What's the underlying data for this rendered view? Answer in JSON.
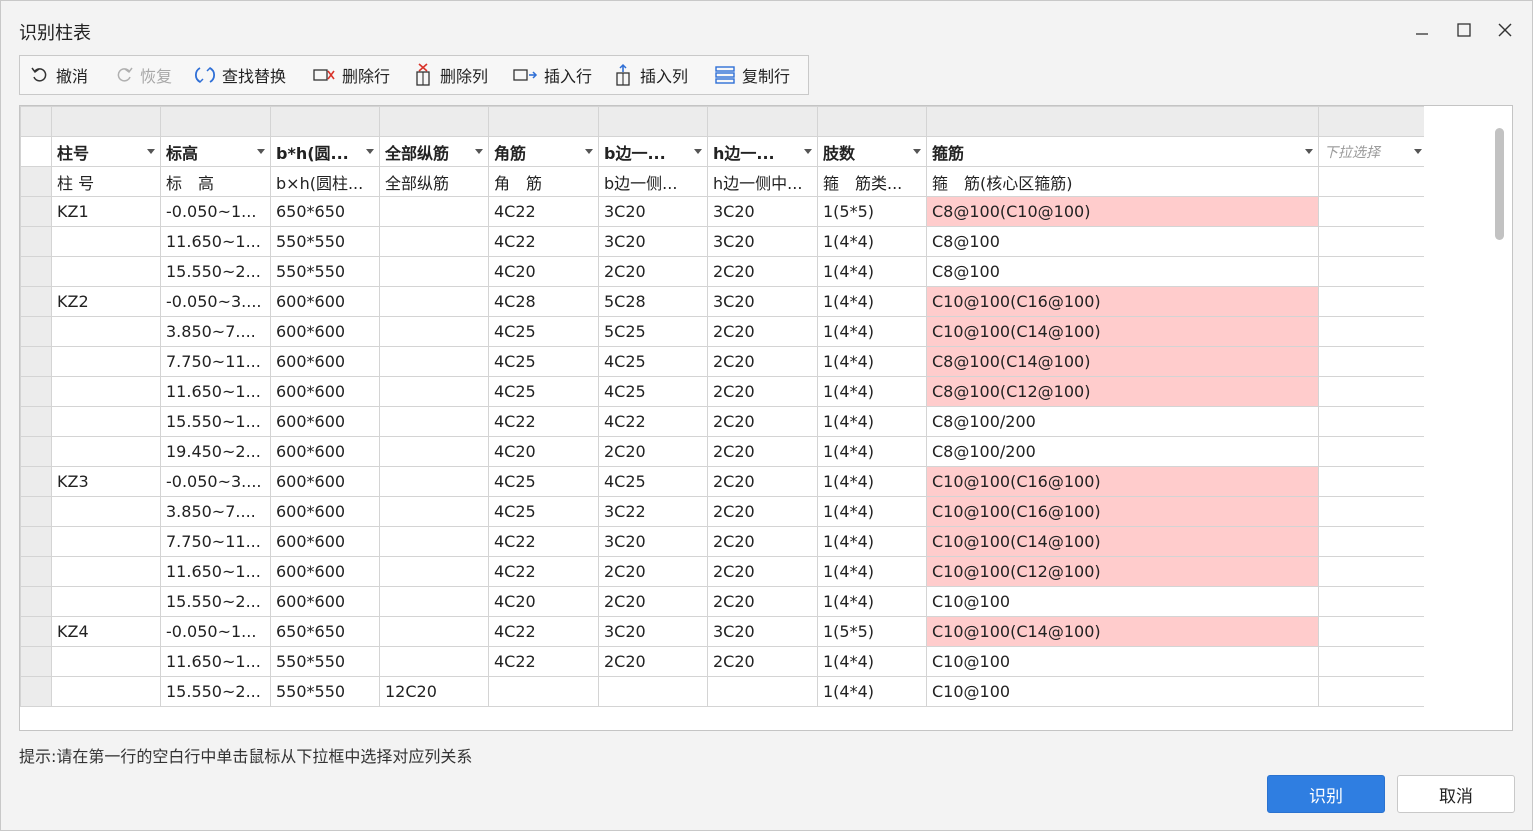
{
  "dialog": {
    "title": "识别柱表"
  },
  "toolbar": {
    "undo": "撤消",
    "redo": "恢复",
    "find_replace": "查找替换",
    "delete_row": "删除行",
    "delete_col": "删除列",
    "insert_row": "插入行",
    "insert_col": "插入列",
    "copy_row": "复制行"
  },
  "table": {
    "header": [
      "柱号",
      "标高",
      "b*h(圆...",
      "全部纵筋",
      "角筋",
      "b边一...",
      "h边一...",
      "肢数",
      "箍筋",
      "下拉选择"
    ],
    "subheader": [
      "柱 号",
      "标　高",
      "b×h(圆柱...",
      "全部纵筋",
      "角　筋",
      "b边一侧...",
      "h边一侧中...",
      "箍　筋类...",
      "箍　筋(核心区箍筋)",
      ""
    ],
    "rows": [
      {
        "c": [
          "KZ1",
          "-0.050~1...",
          "650*650",
          "",
          "4C22",
          "3C20",
          "3C20",
          "1(5*5)",
          "C8@100(C10@100)",
          ""
        ],
        "hl": true
      },
      {
        "c": [
          "",
          "11.650~1...",
          "550*550",
          "",
          "4C22",
          "3C20",
          "3C20",
          "1(4*4)",
          "C8@100",
          ""
        ],
        "hl": false
      },
      {
        "c": [
          "",
          "15.550~2...",
          "550*550",
          "",
          "4C20",
          "2C20",
          "2C20",
          "1(4*4)",
          "C8@100",
          ""
        ],
        "hl": false
      },
      {
        "c": [
          "KZ2",
          "-0.050~3....",
          "600*600",
          "",
          "4C28",
          "5C28",
          "3C20",
          "1(4*4)",
          "C10@100(C16@100)",
          ""
        ],
        "hl": true
      },
      {
        "c": [
          "",
          "3.850~7....",
          "600*600",
          "",
          "4C25",
          "5C25",
          "2C20",
          "1(4*4)",
          "C10@100(C14@100)",
          ""
        ],
        "hl": true
      },
      {
        "c": [
          "",
          "7.750~11...",
          "600*600",
          "",
          "4C25",
          "4C25",
          "2C20",
          "1(4*4)",
          "C8@100(C14@100)",
          ""
        ],
        "hl": true
      },
      {
        "c": [
          "",
          "11.650~1...",
          "600*600",
          "",
          "4C25",
          "4C25",
          "2C20",
          "1(4*4)",
          "C8@100(C12@100)",
          ""
        ],
        "hl": true
      },
      {
        "c": [
          "",
          "15.550~1...",
          "600*600",
          "",
          "4C22",
          "4C22",
          "2C20",
          "1(4*4)",
          "C8@100/200",
          ""
        ],
        "hl": false
      },
      {
        "c": [
          "",
          "19.450~2...",
          "600*600",
          "",
          "4C20",
          "2C20",
          "2C20",
          "1(4*4)",
          "C8@100/200",
          ""
        ],
        "hl": false
      },
      {
        "c": [
          "KZ3",
          "-0.050~3....",
          "600*600",
          "",
          "4C25",
          "4C25",
          "2C20",
          "1(4*4)",
          "C10@100(C16@100)",
          ""
        ],
        "hl": true
      },
      {
        "c": [
          "",
          "3.850~7....",
          "600*600",
          "",
          "4C25",
          "3C22",
          "2C20",
          "1(4*4)",
          "C10@100(C16@100)",
          ""
        ],
        "hl": true
      },
      {
        "c": [
          "",
          "7.750~11...",
          "600*600",
          "",
          "4C22",
          "3C20",
          "2C20",
          "1(4*4)",
          "C10@100(C14@100)",
          ""
        ],
        "hl": true
      },
      {
        "c": [
          "",
          "11.650~1...",
          "600*600",
          "",
          "4C22",
          "2C20",
          "2C20",
          "1(4*4)",
          "C10@100(C12@100)",
          ""
        ],
        "hl": true
      },
      {
        "c": [
          "",
          "15.550~2...",
          "600*600",
          "",
          "4C20",
          "2C20",
          "2C20",
          "1(4*4)",
          "C10@100",
          ""
        ],
        "hl": false
      },
      {
        "c": [
          "KZ4",
          "-0.050~1...",
          "650*650",
          "",
          "4C22",
          "3C20",
          "3C20",
          "1(5*5)",
          "C10@100(C14@100)",
          ""
        ],
        "hl": true
      },
      {
        "c": [
          "",
          "11.650~1...",
          "550*550",
          "",
          "4C22",
          "2C20",
          "2C20",
          "1(4*4)",
          "C10@100",
          ""
        ],
        "hl": false
      },
      {
        "c": [
          "",
          "15.550~2...",
          "550*550",
          "12C20",
          "",
          "",
          "",
          "1(4*4)",
          "C10@100",
          ""
        ],
        "hl": false
      }
    ]
  },
  "hint": "提示:请在第一行的空白行中单击鼠标从下拉框中选择对应列关系",
  "buttons": {
    "ok": "识别",
    "cancel": "取消"
  },
  "colors": {
    "highlight": "#ffcccc",
    "primary": "#2f7ee1"
  }
}
